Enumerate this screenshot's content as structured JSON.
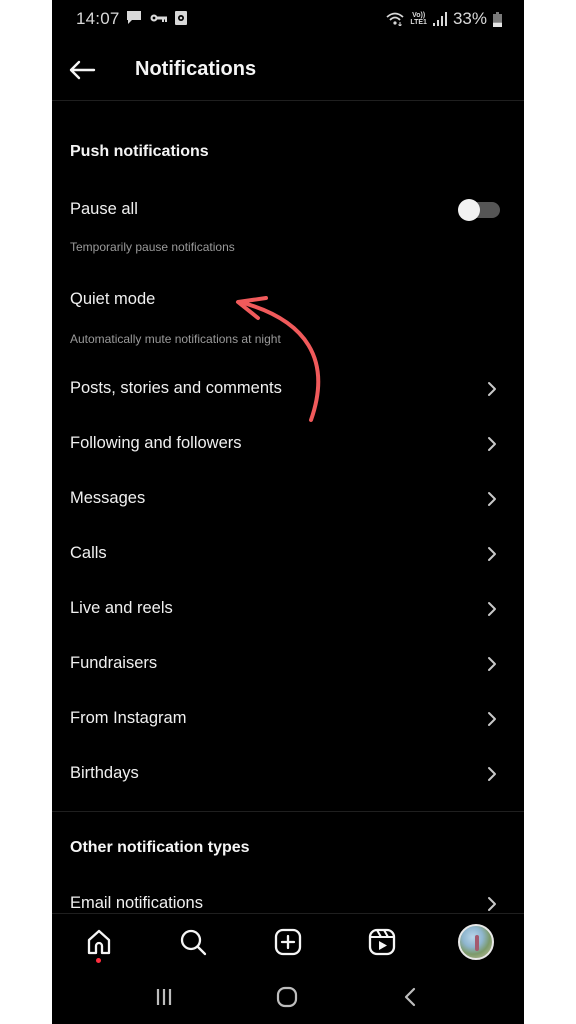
{
  "status_bar": {
    "time": "14:07",
    "left_icons": [
      "message-icon",
      "vpn-key-icon",
      "screen-record-icon"
    ],
    "network_label_top": "Vo))",
    "network_label_bottom": "LTE1",
    "battery_percent": "33%",
    "battery_level": 0.33
  },
  "header": {
    "title": "Notifications",
    "back_icon": "arrow-left-icon"
  },
  "push_section": {
    "title": "Push notifications",
    "pause_all": {
      "label": "Pause all",
      "description": "Temporarily pause notifications",
      "enabled": false
    },
    "quiet_mode": {
      "label": "Quiet mode",
      "description": "Automatically mute notifications at night"
    },
    "items": [
      {
        "label": "Posts, stories and comments"
      },
      {
        "label": "Following and followers"
      },
      {
        "label": "Messages"
      },
      {
        "label": "Calls"
      },
      {
        "label": "Live and reels"
      },
      {
        "label": "Fundraisers"
      },
      {
        "label": "From Instagram"
      },
      {
        "label": "Birthdays"
      }
    ]
  },
  "other_section": {
    "title": "Other notification types",
    "items": [
      {
        "label": "Email notifications"
      }
    ]
  },
  "annotation": {
    "type": "curved-arrow",
    "color": "#f05a5b",
    "points_to": "Quiet mode"
  },
  "bottom_nav": {
    "tabs": [
      "home-icon",
      "search-icon",
      "create-icon",
      "reels-icon",
      "profile-avatar"
    ],
    "active": "home",
    "home_badge_color": "#ff3040"
  },
  "system_nav": [
    "recent-apps-icon",
    "home-circle-icon",
    "back-chevron-icon"
  ]
}
